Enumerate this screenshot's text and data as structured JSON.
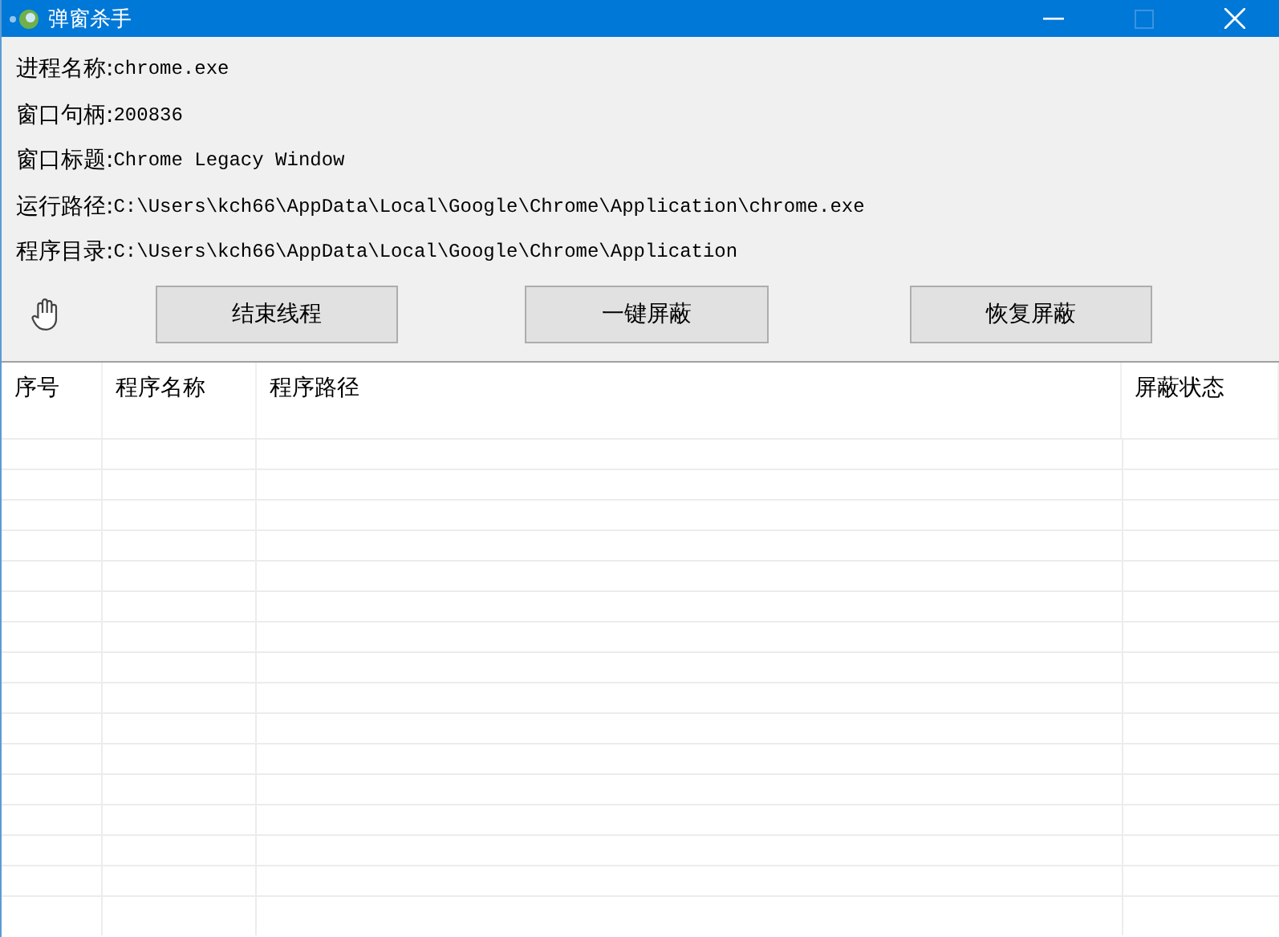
{
  "window": {
    "title": "弹窗杀手"
  },
  "info": [
    {
      "label": "进程名称:",
      "value": "chrome.exe"
    },
    {
      "label": "窗口句柄:",
      "value": "200836"
    },
    {
      "label": "窗口标题:",
      "value": "Chrome Legacy Window"
    },
    {
      "label": "运行路径:",
      "value": "C:\\Users\\kch66\\AppData\\Local\\Google\\Chrome\\Application\\chrome.exe"
    },
    {
      "label": "程序目录:",
      "value": "C:\\Users\\kch66\\AppData\\Local\\Google\\Chrome\\Application"
    }
  ],
  "buttons": [
    "结束线程",
    "一键屏蔽",
    "恢复屏蔽"
  ],
  "table": {
    "columns": [
      "序号",
      "程序名称",
      "程序路径",
      "屏蔽状态"
    ]
  }
}
